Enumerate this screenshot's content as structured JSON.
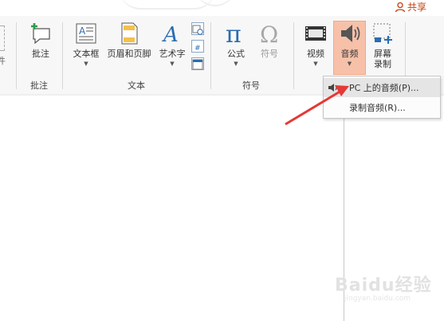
{
  "share": {
    "label": "共享"
  },
  "ribbon": {
    "comments": {
      "comment_label": "批注",
      "group_label": "批注",
      "left_cut_label": "件"
    },
    "text": {
      "textbox_label": "文本框",
      "header_footer_label": "页眉和页脚",
      "wordart_label": "艺术字",
      "group_label": "文本"
    },
    "symbols": {
      "equation_label": "公式",
      "symbol_label": "符号",
      "group_label": "符号"
    },
    "media": {
      "video_label": "视频",
      "audio_label": "音频",
      "screen_recording_line1": "屏幕",
      "screen_recording_line2": "录制"
    }
  },
  "audio_menu": {
    "items": [
      {
        "label": "PC 上的音频(P)...",
        "icon": "speaker-icon"
      },
      {
        "label": "录制音频(R)..."
      }
    ]
  },
  "watermark": {
    "text": "Baidu经验",
    "sub": "jingyan.baidu.com"
  },
  "colors": {
    "accent_pressed": "#f7c1a9",
    "arrow": "#e53935",
    "ribbon_bg": "#f7f7f7",
    "share": "#c2410c"
  }
}
